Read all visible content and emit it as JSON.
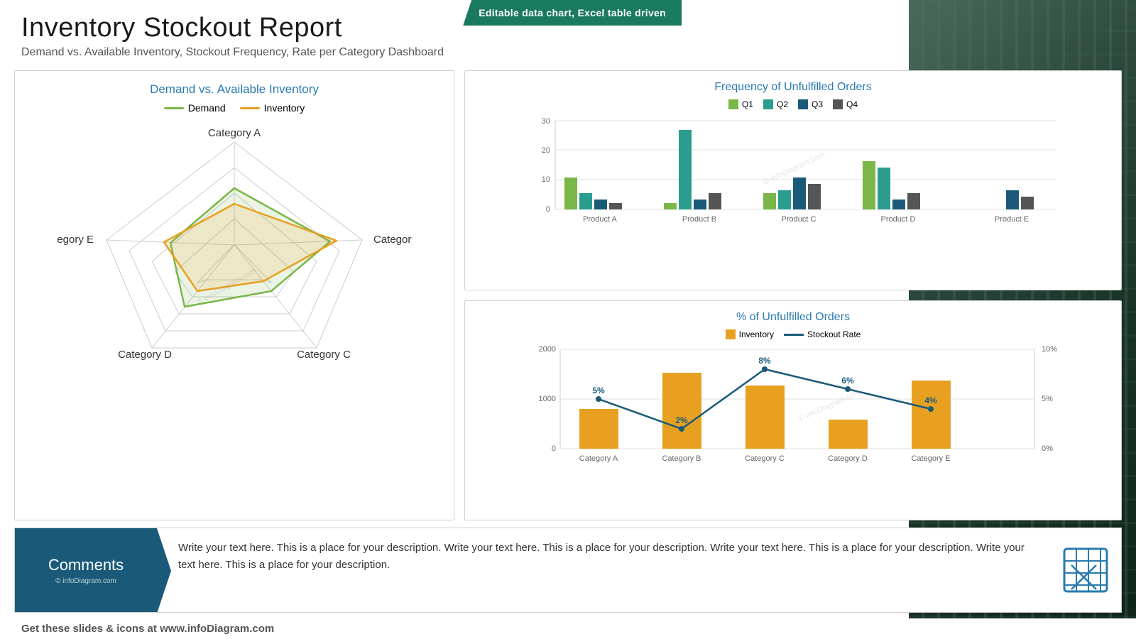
{
  "header": {
    "title": "Inventory Stockout Report",
    "subtitle": "Demand vs. Available Inventory, Stockout Frequency, Rate per Category Dashboard",
    "badge": "Editable data chart, Excel table driven"
  },
  "radar_chart": {
    "title": "Demand vs. Available Inventory",
    "legend": {
      "demand_label": "Demand",
      "demand_color": "#7ab648",
      "inventory_label": "Inventory",
      "inventory_color": "#e8a020"
    },
    "categories": [
      "Category A",
      "Category B",
      "Category C",
      "Category D",
      "Category E"
    ],
    "demand_values": [
      0.55,
      0.75,
      0.45,
      0.6,
      0.5
    ],
    "inventory_values": [
      0.4,
      0.8,
      0.35,
      0.45,
      0.55
    ]
  },
  "bar_chart_1": {
    "title": "Frequency of Unfulfilled Orders",
    "legend": [
      {
        "label": "Q1",
        "color": "#7ab648"
      },
      {
        "label": "Q2",
        "color": "#2a9d8f"
      },
      {
        "label": "Q3",
        "color": "#1a5a78"
      },
      {
        "label": "Q4",
        "color": "#555555"
      }
    ],
    "products": [
      "Product A",
      "Product B",
      "Product C",
      "Product D",
      "Product E"
    ],
    "data": {
      "Q1": [
        10,
        2,
        5,
        15,
        0
      ],
      "Q2": [
        5,
        25,
        6,
        13,
        0
      ],
      "Q3": [
        3,
        3,
        10,
        3,
        6
      ],
      "Q4": [
        2,
        5,
        8,
        5,
        4
      ]
    },
    "y_max": 30,
    "y_ticks": [
      0,
      10,
      20,
      30
    ]
  },
  "bar_chart_2": {
    "title": "% of  Unfulfilled Orders",
    "legend": [
      {
        "label": "Inventory",
        "color": "#e8a020",
        "type": "bar"
      },
      {
        "label": "Stockout Rate",
        "color": "#1a5a78",
        "type": "line"
      }
    ],
    "categories": [
      "Category A",
      "Category B",
      "Category C",
      "Category D",
      "Category E"
    ],
    "inventory_values": [
      750,
      1450,
      1200,
      550,
      1300
    ],
    "stockout_rates": [
      5,
      2,
      8,
      6,
      4
    ],
    "stockout_labels": [
      "5%",
      "2%",
      "8%",
      "6%",
      "4%"
    ],
    "y_left_max": 2000,
    "y_left_ticks": [
      0,
      1000,
      2000
    ],
    "y_right_max": 10,
    "y_right_ticks": [
      "0%",
      "5%",
      "10%"
    ]
  },
  "comments": {
    "label": "Comments",
    "watermark": "© infoDiagram.com",
    "text": "Write your text here. This is a place for your description. Write your text here. This is a place for your description. Write your text here. This is a place for your description. Write your text here. This is a place for your description."
  },
  "footer": {
    "text_before": "Get these slides & icons at www.",
    "brand": "infoDiagram",
    "text_after": ".com"
  },
  "watermark_text": "© infoDiagram.com"
}
